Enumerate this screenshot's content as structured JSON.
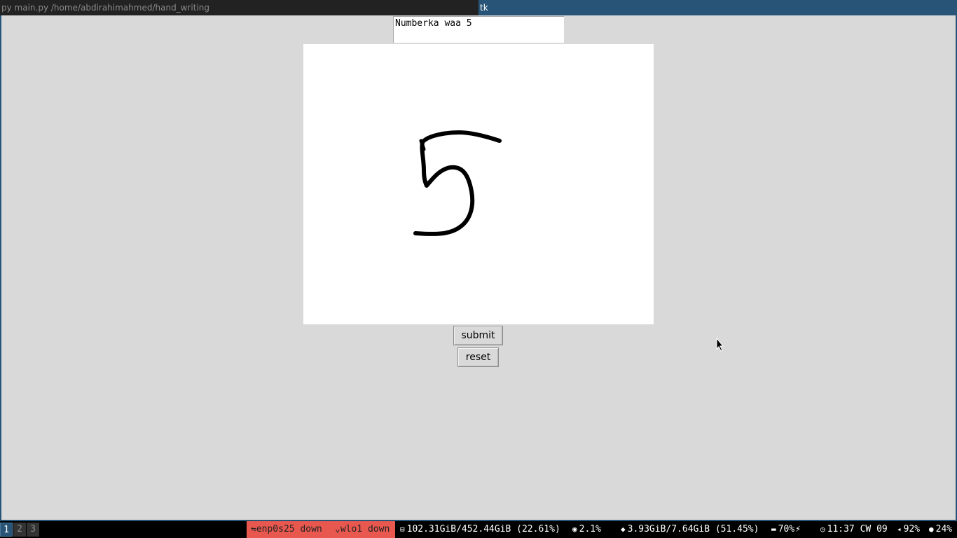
{
  "window": {
    "left_title": "py main.py /home/abdirahimahmed/hand_writing",
    "right_title": "tk"
  },
  "app": {
    "result_text": "Numberka waa 5",
    "submit_label": "submit",
    "reset_label": "reset"
  },
  "statusbar": {
    "workspaces": [
      "1",
      "2",
      "3"
    ],
    "ethernet": "enp0s25 down",
    "wifi": "wlo1 down",
    "disk": "102.31GiB/452.44GiB (22.61%)",
    "cpu": "2.1%",
    "memory": "3.93GiB/7.64GiB (51.45%)",
    "battery": "70%",
    "time": "11:37 CW 09",
    "volume": "92%",
    "mic": "24%"
  },
  "colors": {
    "focused_title_bg": "#285577",
    "unfocused_title_bg": "#222222",
    "alert_bg": "#e8584f",
    "window_bg": "#d9d9d9"
  }
}
